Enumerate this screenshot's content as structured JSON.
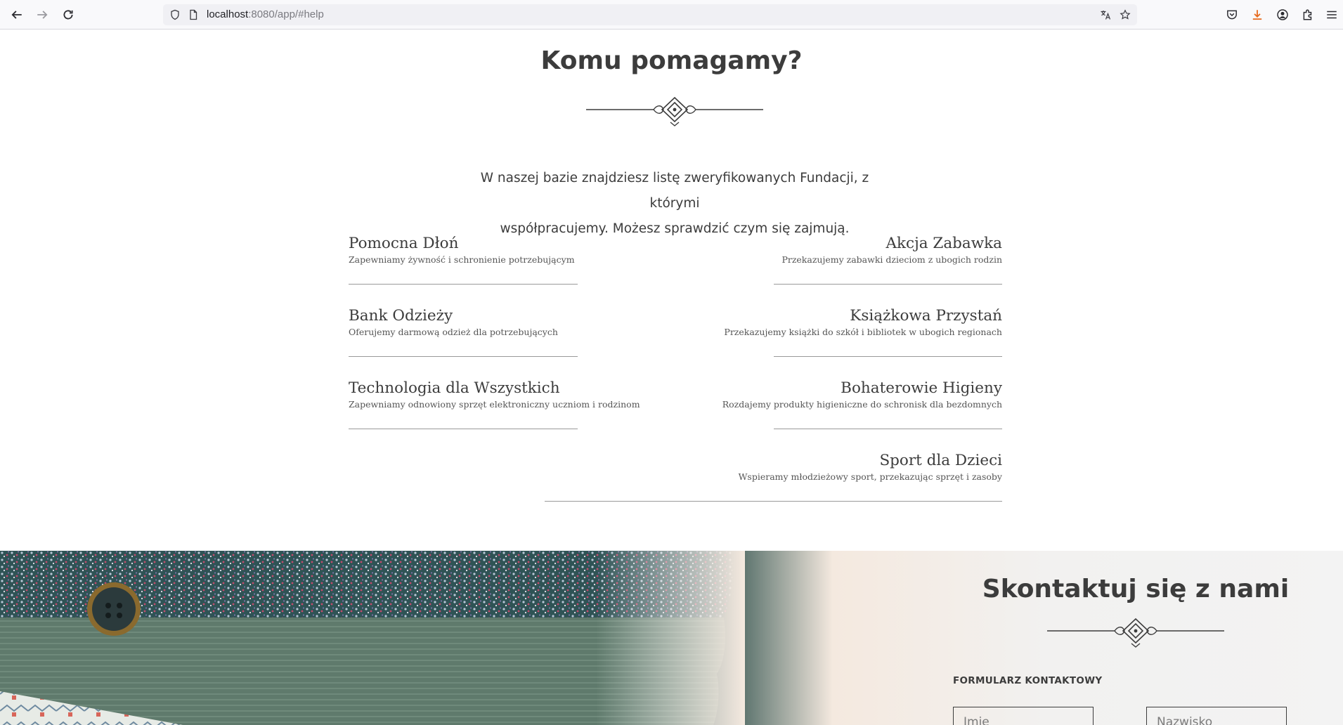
{
  "browser": {
    "url_host": "localhost",
    "url_rest": ":8080/app/#help"
  },
  "help": {
    "title": "Komu pomagamy?",
    "description_line1": "W naszej bazie znajdziesz listę zweryfikowanych Fundacji, z którymi",
    "description_line2": "współpracujemy. Możesz sprawdzić czym się zajmują.",
    "organizations": [
      {
        "name": "Pomocna Dłoń",
        "description": "Zapewniamy żywność i schronienie potrzebującym"
      },
      {
        "name": "Akcja Zabawka",
        "description": "Przekazujemy zabawki dzieciom z ubogich rodzin"
      },
      {
        "name": "Bank Odzieży",
        "description": "Oferujemy darmową odzież dla potrzebujących"
      },
      {
        "name": "Książkowa Przystań",
        "description": "Przekazujemy książki do szkół i bibliotek w ubogich regionach"
      },
      {
        "name": "Technologia dla Wszystkich",
        "description": "Zapewniamy odnowiony sprzęt elektroniczny uczniom i rodzinom"
      },
      {
        "name": "Bohaterowie Higieny",
        "description": "Rozdajemy produkty higieniczne do schronisk dla bezdomnych"
      },
      {
        "name": "Sport dla Dzieci",
        "description": "Wspieramy młodzieżowy sport, przekazując sprzęt i zasoby"
      }
    ]
  },
  "contact": {
    "title": "Skontaktuj się z nami",
    "form_label": "FORMULARZ KONTAKTOWY",
    "first_name_placeholder": "Imię",
    "last_name_placeholder": "Nazwisko"
  },
  "colors": {
    "text": "#3c3c3c",
    "rule": "#9a9a9a"
  }
}
